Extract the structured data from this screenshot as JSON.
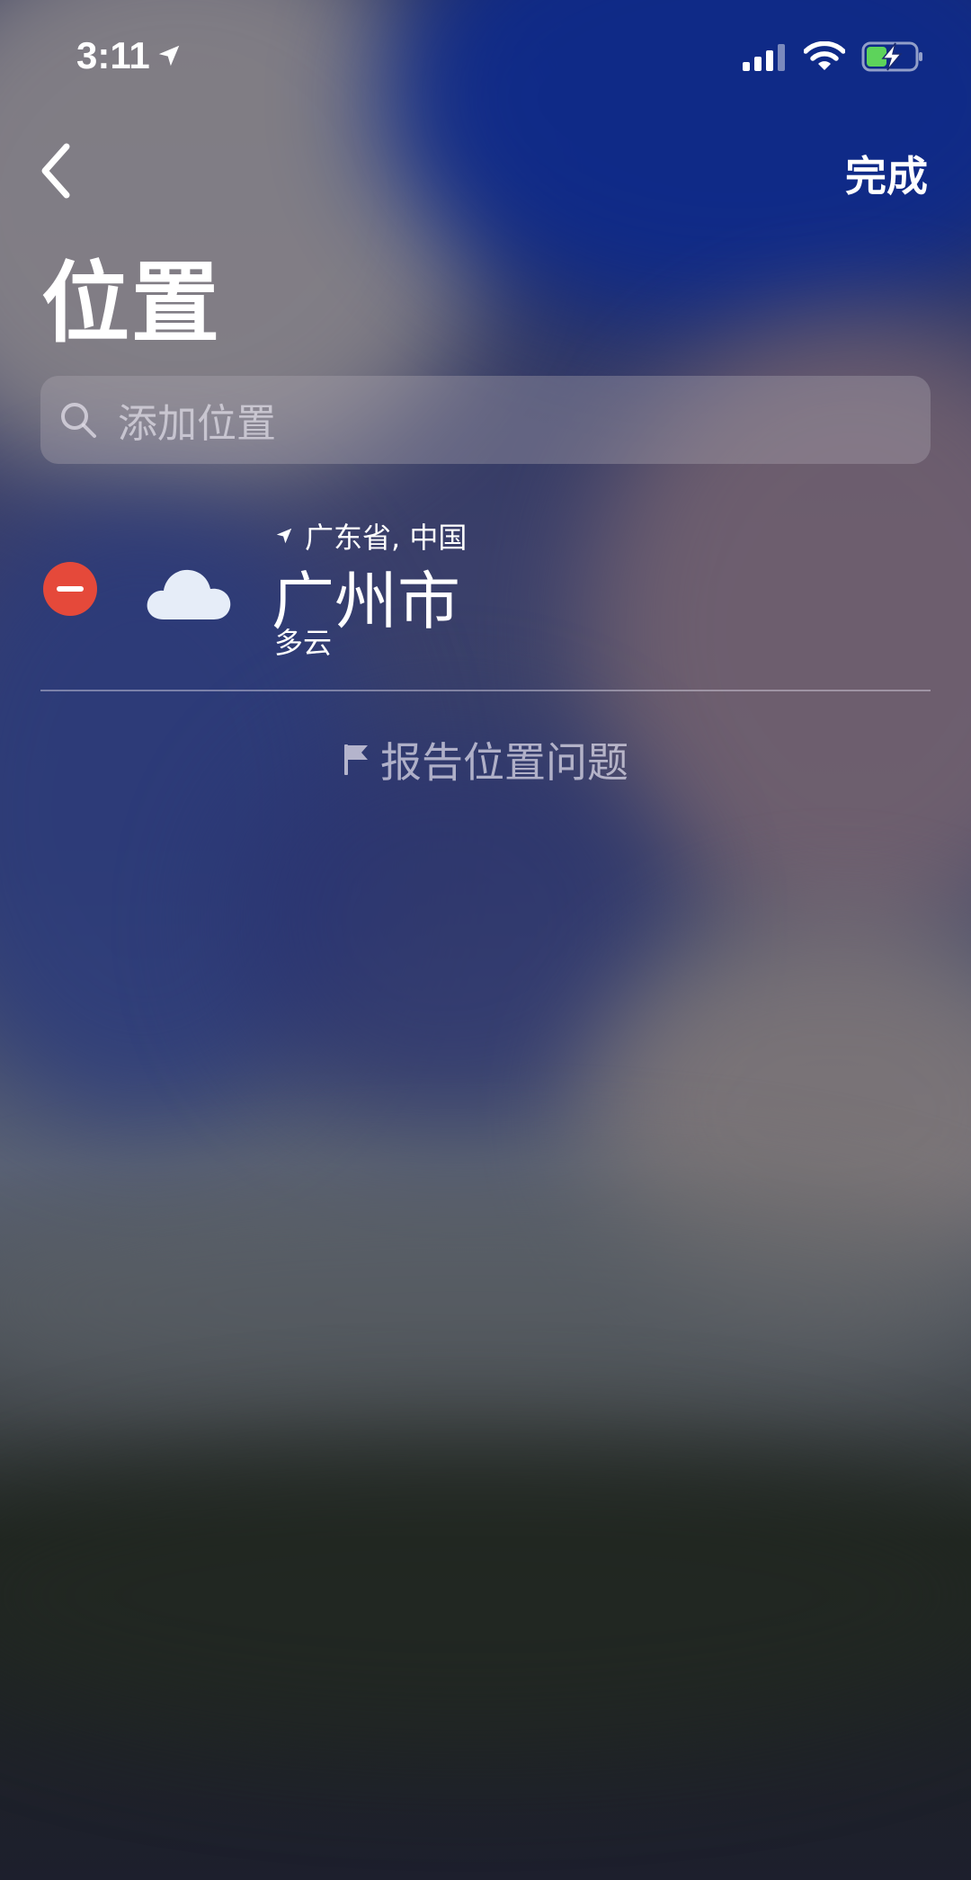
{
  "status_bar": {
    "time": "3:11"
  },
  "nav": {
    "back_icon": "chevron-left-icon",
    "done_label": "完成"
  },
  "page": {
    "title": "位置"
  },
  "search": {
    "placeholder": "添加位置",
    "icon": "search-icon"
  },
  "locations": [
    {
      "region": "广东省, 中国",
      "city": "广州市",
      "condition": "多云",
      "weather_icon": "cloud-icon"
    }
  ],
  "report": {
    "label": "报告位置问题",
    "icon": "flag-icon"
  },
  "colors": {
    "delete_red": "#e5493a",
    "battery_green": "#5dd35b"
  }
}
